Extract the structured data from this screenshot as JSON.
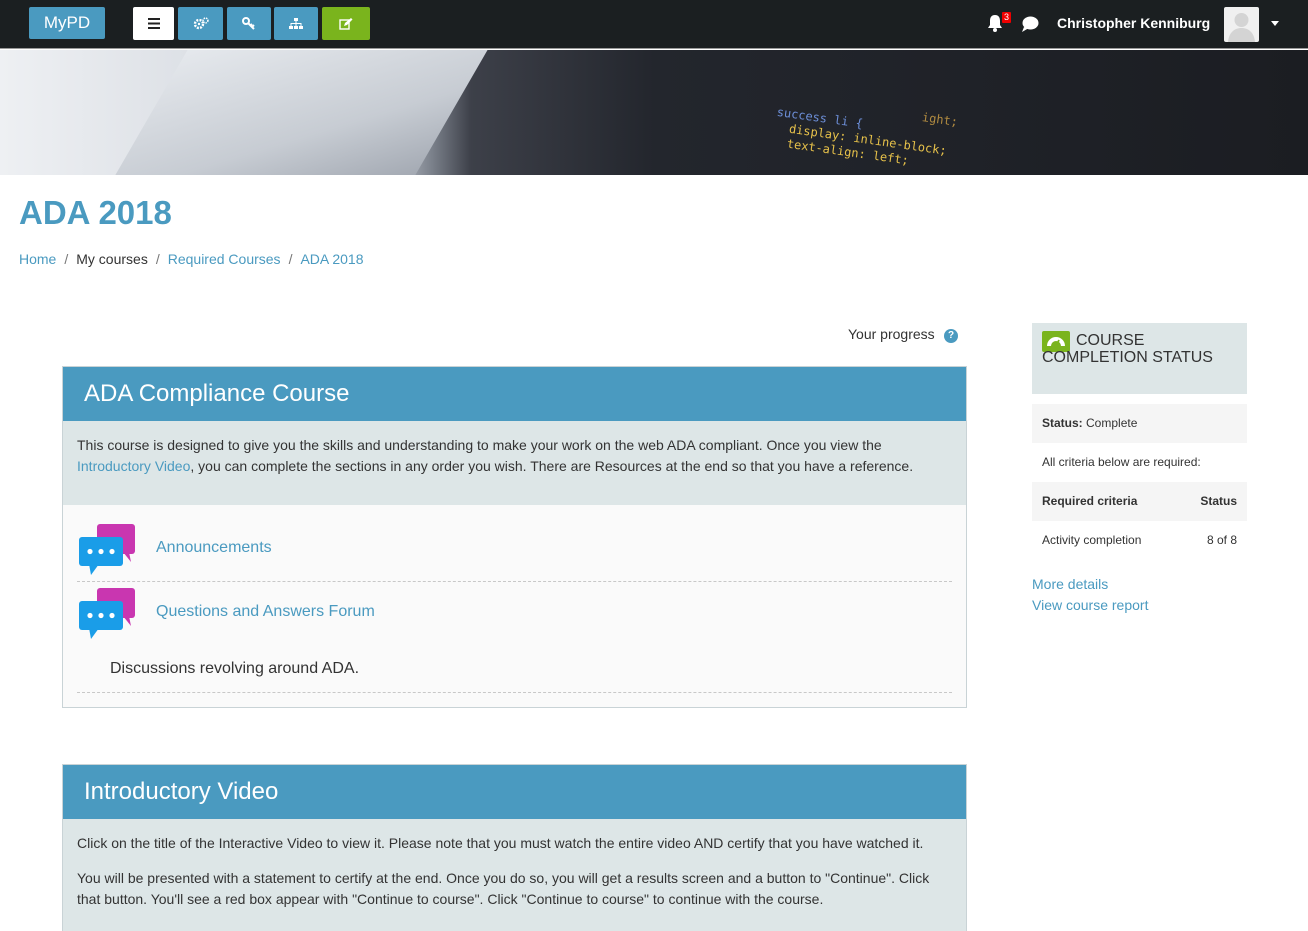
{
  "navbar": {
    "brand": "MyPD",
    "notification_count": "3",
    "user_name": "Christopher Kenniburg",
    "buttons": [
      "menu-icon",
      "cogs-icon",
      "key-icon",
      "sitemap-icon",
      "edit-icon"
    ]
  },
  "banner": {
    "code_lines": [
      "                    ight;",
      "",
      "success li {",
      "  display: inline-block;",
      "  text-align: left;"
    ]
  },
  "page": {
    "title": "ADA 2018",
    "breadcrumb": [
      "Home",
      "My courses",
      "Required Courses",
      "ADA 2018"
    ]
  },
  "progress": {
    "label": "Your progress",
    "help_glyph": "?"
  },
  "section1": {
    "title": "ADA Compliance Course",
    "summary_before": "This course is designed to give you the skills and understanding to make your work on the web ADA compliant. Once you view the ",
    "summary_link": "Introductory Video",
    "summary_after": ", you can complete the sections in any order you wish. There are Resources at the end so that you have a reference.",
    "activities": [
      {
        "name": "Announcements",
        "description": ""
      },
      {
        "name": "Questions and Answers Forum",
        "description": "Discussions revolving around ADA."
      }
    ]
  },
  "section2": {
    "title": "Introductory Video",
    "paragraphs": [
      "Click on the title of the Interactive Video to view it. Please note that you must watch the entire video AND certify that you have watched it.",
      "You will be presented with a statement to certify at the end. Once you do so, you will get a results screen and a button to \"Continue\". Click that button. You'll see a red box appear with \"Continue to course\". Click \"Continue to course\" to continue with the course."
    ]
  },
  "completion_block": {
    "title": "COURSE COMPLETION STATUS",
    "status_label": "Status:",
    "status_value": "Complete",
    "criteria_note": "All criteria below are required:",
    "col_criteria": "Required criteria",
    "col_status": "Status",
    "criteria_name": "Activity completion",
    "criteria_value": "8 of 8",
    "more_details": "More details",
    "view_report": "View course report"
  },
  "colors": {
    "accent": "#4a9ac0",
    "green": "#7ab41d",
    "navbar": "#1b1f21",
    "section_bg": "#dde6e7"
  }
}
